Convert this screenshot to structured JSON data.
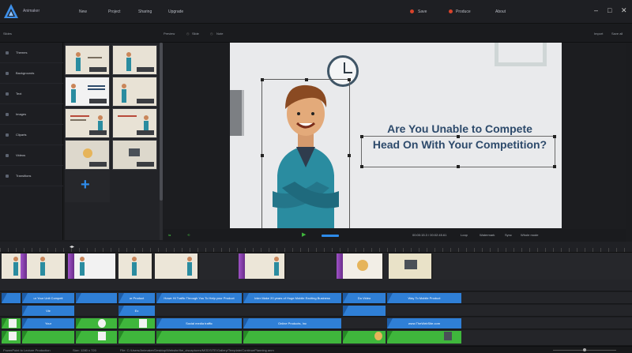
{
  "app": {
    "name": "Animaker",
    "nav": [
      "New",
      "Project",
      "Sharing",
      "Upgrade"
    ],
    "right_nav": [
      "Save",
      "Produce",
      "About"
    ],
    "window_controls": [
      "–",
      "□",
      "✕"
    ],
    "accent_color": "#2e8bea",
    "dot_color": "#d8432b"
  },
  "toolbar": {
    "left_label": "Slides",
    "center": [
      "Preview",
      "Slide",
      "Note"
    ],
    "right": [
      "Import",
      "Save all"
    ]
  },
  "sidebar": {
    "items": [
      {
        "label": "Themes",
        "icon": "themes-icon"
      },
      {
        "label": "Backgrounds",
        "icon": "backgrounds-icon"
      },
      {
        "label": "Text",
        "icon": "text-icon"
      },
      {
        "label": "Images",
        "icon": "images-icon"
      },
      {
        "label": "Cliparts",
        "icon": "cliparts-icon"
      },
      {
        "label": "Videos",
        "icon": "videos-icon"
      },
      {
        "label": "Transitions",
        "icon": "transitions-icon"
      }
    ]
  },
  "templates": {
    "add_label": "+"
  },
  "preview": {
    "headline_line1": "Are You Unable to Compete",
    "headline_line2": "Head On With Your Competition?"
  },
  "player": {
    "time": "00:00:15.3 / 00:02:45.61",
    "opts": [
      "Loop",
      "Watermark",
      "Sync",
      "Whole mode"
    ]
  },
  "timeline": {
    "text_clips": [
      "ur Your Unit Competi",
      "Vie",
      "Ex",
      "ur Product",
      "Howe Hi Traffic Through You To Help your Product",
      "Inter Make 20 years of Huge Mobile Exciting Business",
      "Do Video",
      "Way To Mobile Product"
    ],
    "image_clips": [
      "Your",
      "Social media traffic",
      "Online Products, Inc",
      "www.TheWebSite.com"
    ]
  },
  "status": {
    "left": "PowerPoint to Lecture Production",
    "mid": "Size: 1280 x 720",
    "path": "File: C:/Users/Animaker/Desktop/Website/the_ciscaptures/MODSITE/Gallery/Template/ContinuePlanning.anm"
  }
}
